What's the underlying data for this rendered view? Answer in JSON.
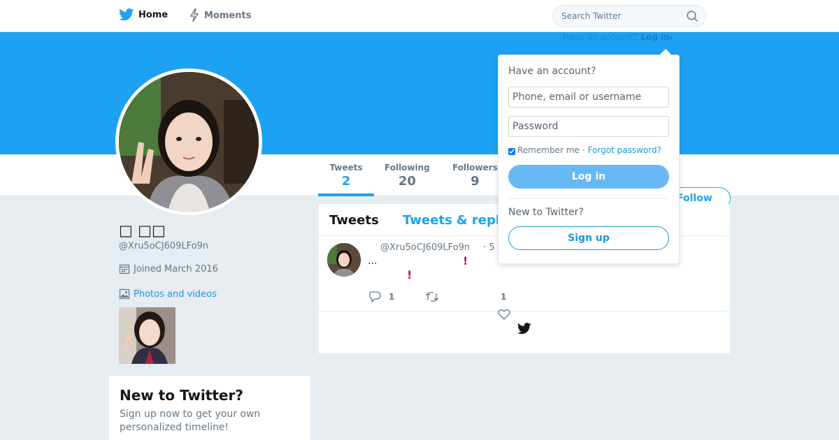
{
  "nav": {
    "home_label": "Home",
    "moments_label": "Moments",
    "search_placeholder": "Search Twitter"
  },
  "account_prompt": {
    "text": "Have an account?",
    "login_label": "Log in"
  },
  "profile": {
    "name": "□ □□",
    "handle": "@Xru5oCJ609LFo9n",
    "joined": "Joined March 2016",
    "photos_label": "Photos and videos",
    "follow_label": "Follow"
  },
  "stats": {
    "tweets_label": "Tweets",
    "tweets_value": "2",
    "following_label": "Following",
    "following_value": "20",
    "followers_label": "Followers",
    "followers_value": "9"
  },
  "timeline": {
    "tab_tweets": "Tweets",
    "tab_replies": "Tweets & repl",
    "tweet": {
      "handle": "@Xru5oCJ609LFo9n",
      "time": "· 5",
      "text": "...",
      "excl_1": "!",
      "excl_2": "!",
      "reply_count": "1",
      "like_count": "1"
    }
  },
  "new_card": {
    "title": "New to Twitter?",
    "body": "Sign up now to get your own personalized timeline!"
  },
  "login_dropdown": {
    "title": "Have an account?",
    "username_placeholder": "Phone, email or username",
    "password_placeholder": "Password",
    "remember_label": "Remember me",
    "separator": "·",
    "forgot_label": "Forgot password?",
    "login_button": "Log in",
    "new_label": "New to Twitter?",
    "signup_button": "Sign up"
  },
  "colors": {
    "brand": "#1da1f2",
    "link": "#1b95e0",
    "background": "#e6ecf0"
  }
}
